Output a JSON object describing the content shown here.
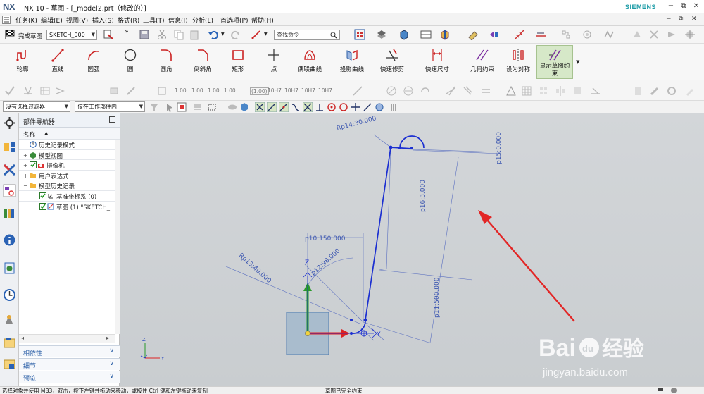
{
  "window": {
    "logo": "NX",
    "title": "NX 10 - 草图 - [_model2.prt（修改的）]",
    "brand": "SIEMENS",
    "controls": [
      "−",
      "⧉",
      "✕"
    ]
  },
  "menu": {
    "items": [
      "任务(K)",
      "编辑(E)",
      "视图(V)",
      "插入(S)",
      "格式(R)",
      "工具(T)",
      "信息(I)",
      "分析(L)",
      "首选项(P)",
      "帮助(H)"
    ],
    "doc_controls": [
      "−",
      "⧉",
      "✕"
    ]
  },
  "toolbar": {
    "finish_label": "完成草图",
    "sketch_name": "SKETCH_000",
    "search_placeholder": "查找命令"
  },
  "ribbon": {
    "buttons": [
      "轮廓",
      "直线",
      "圆弧",
      "圆",
      "圆角",
      "倒斜角",
      "矩形",
      "点",
      "偶联曲线",
      "投影曲线",
      "快速修剪",
      "快速尺寸",
      "几何约束",
      "设为对称",
      "显示草图约束"
    ]
  },
  "constraint_toolbar": {
    "dims": [
      "1.00",
      "1.00",
      "1.00",
      "1.00",
      "(1.00)",
      "10H7",
      "10H7",
      "10H7",
      "10H7"
    ]
  },
  "selection_bar": {
    "filter": "没有选择过滤器",
    "scope": "仅在工作部件内"
  },
  "navigator": {
    "title": "部件导航器",
    "column": "名称",
    "tree": [
      {
        "label": "历史记录模式",
        "indent": 0,
        "expander": ""
      },
      {
        "label": "模型视图",
        "indent": 0,
        "expander": "+"
      },
      {
        "label": "摄像机",
        "indent": 0,
        "expander": "+"
      },
      {
        "label": "用户表达式",
        "indent": 0,
        "expander": "+"
      },
      {
        "label": "模型历史记录",
        "indent": 0,
        "expander": "−"
      },
      {
        "label": "基准坐标系 (0)",
        "indent": 1,
        "expander": ""
      },
      {
        "label": "草图 (1) \"SKETCH_",
        "indent": 1,
        "expander": ""
      }
    ],
    "panels": [
      "相依性",
      "细节",
      "预览"
    ]
  },
  "sketch": {
    "dimensions": [
      "Rp14:30.000",
      "p15:0.000",
      "p16:3.000",
      "p10:150.000",
      "p12:98.000",
      "Rp13:40.000",
      "p11:500.000"
    ],
    "axis_labels": [
      "Z",
      "Y"
    ]
  },
  "watermark": {
    "brand": "Bai",
    "paw": "du",
    "cn": "经验",
    "url": "jingyan.baidu.com"
  },
  "status": {
    "left": "选择对象并使用 MB3，双击，按下左键并拖动来移动，或按住 Ctrl 键和左键拖动来复制",
    "middle": "草图已完全约束"
  }
}
